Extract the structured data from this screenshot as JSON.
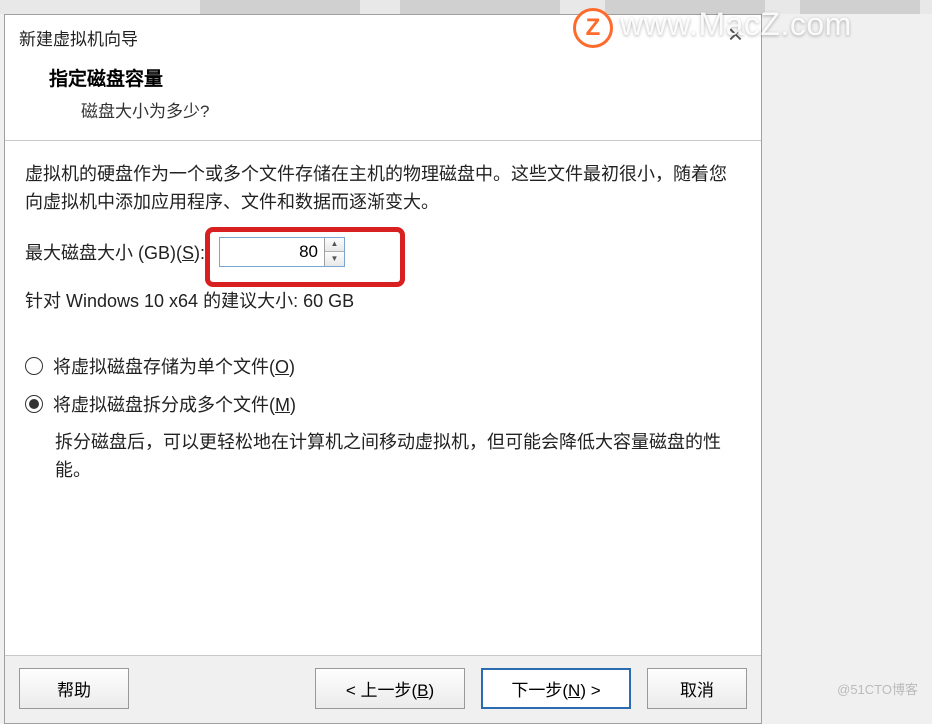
{
  "watermark": {
    "badge": "Z",
    "text": "www.MacZ.com",
    "footer": "@51CTO博客"
  },
  "dialog": {
    "title": "新建虚拟机向导",
    "close": "×",
    "header": {
      "title": "指定磁盘容量",
      "subtitle": "磁盘大小为多少?"
    },
    "body": {
      "description": "虚拟机的硬盘作为一个或多个文件存储在主机的物理磁盘中。这些文件最初很小，随着您向虚拟机中添加应用程序、文件和数据而逐渐变大。",
      "disk_size_label_prefix": "最大磁盘大小 (GB)(",
      "disk_size_label_underline": "S",
      "disk_size_label_suffix": "):",
      "disk_size_value": "80",
      "recommend": "针对 Windows 10 x64 的建议大小: 60 GB",
      "radio_single_prefix": "将虚拟磁盘存储为单个文件(",
      "radio_single_underline": "O",
      "radio_single_suffix": ")",
      "radio_split_prefix": "将虚拟磁盘拆分成多个文件(",
      "radio_split_underline": "M",
      "radio_split_suffix": ")",
      "split_description": "拆分磁盘后，可以更轻松地在计算机之间移动虚拟机，但可能会降低大容量磁盘的性能。"
    },
    "buttons": {
      "help": "帮助",
      "back_prefix": "< 上一步(",
      "back_underline": "B",
      "back_suffix": ")",
      "next_prefix": "下一步(",
      "next_underline": "N",
      "next_suffix": ") >",
      "cancel": "取消"
    }
  }
}
